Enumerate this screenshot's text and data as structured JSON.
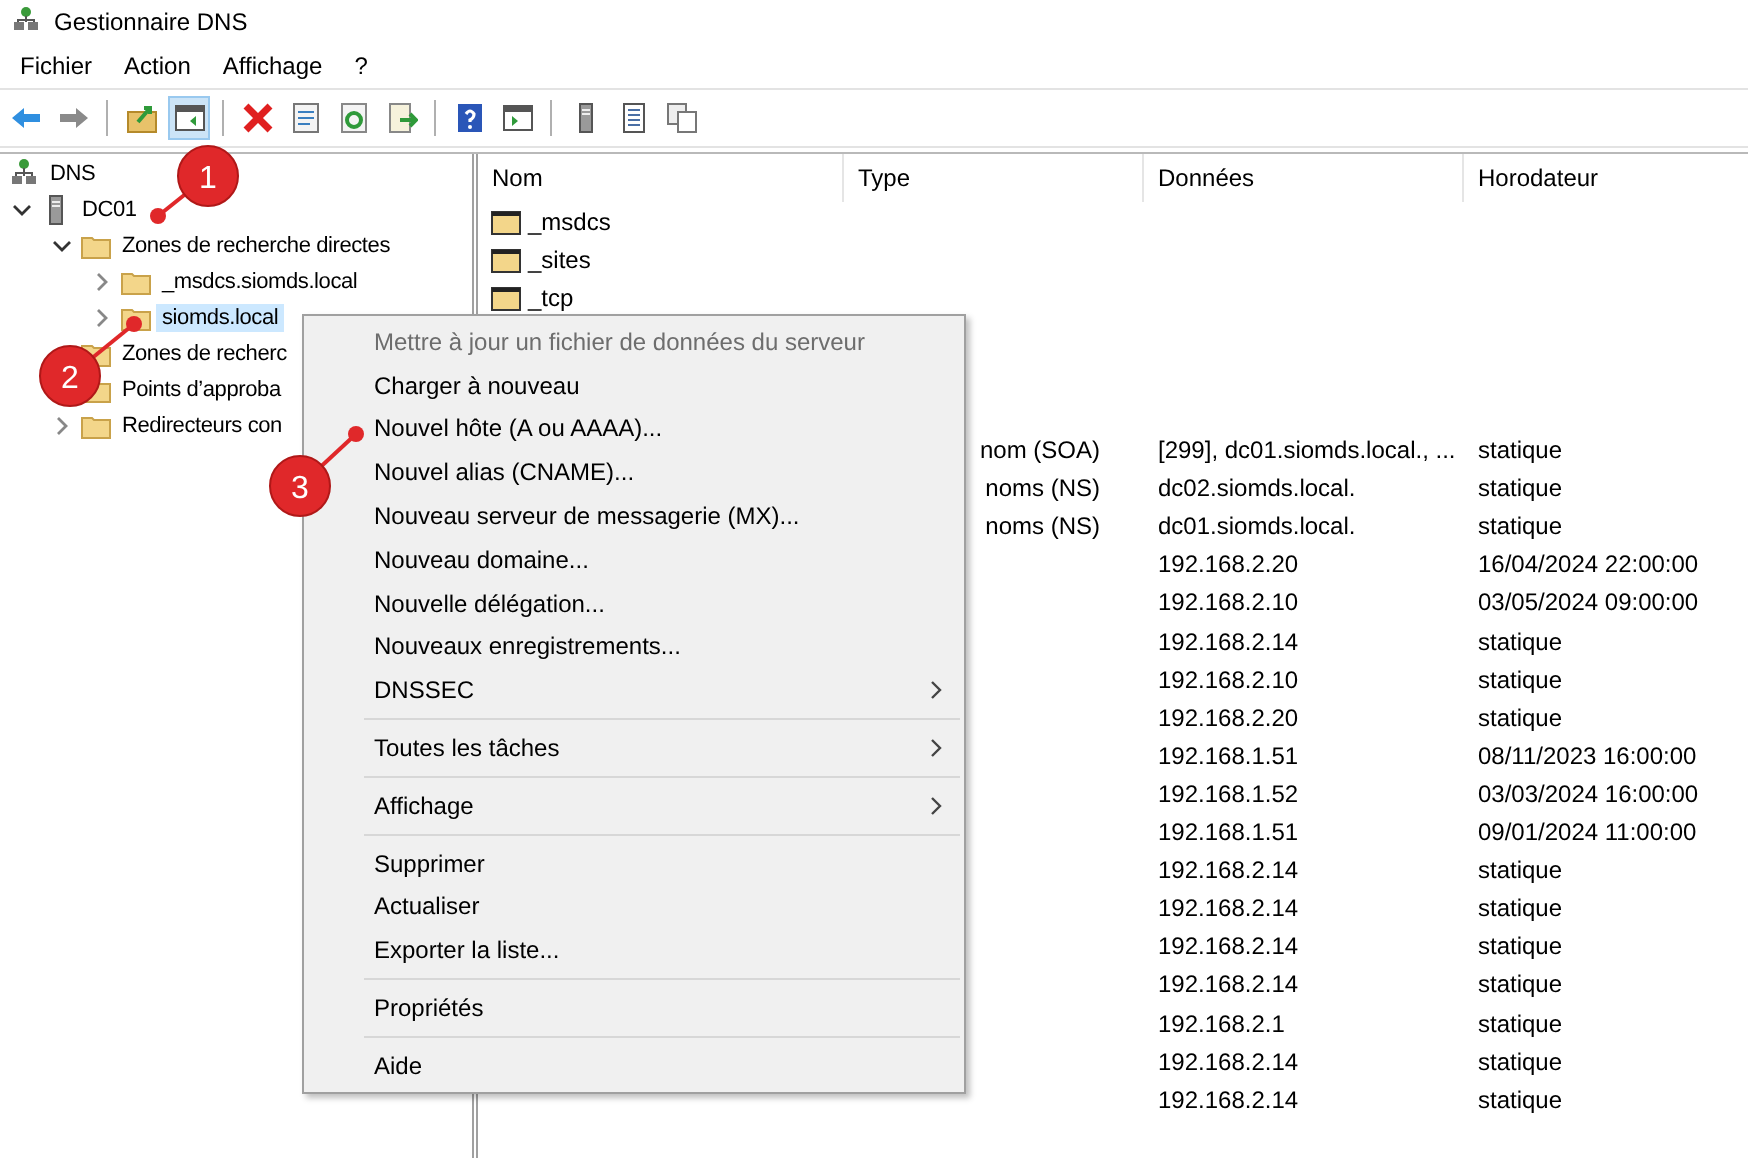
{
  "window": {
    "title": "Gestionnaire DNS"
  },
  "menu_bar": [
    "Fichier",
    "Action",
    "Affichage",
    "?"
  ],
  "toolbar": [
    [
      {
        "pressed": false
      },
      {
        "pressed": false
      }
    ],
    [
      {
        "pressed": false
      },
      {
        "pressed": true
      }
    ],
    [
      {
        "pressed": false
      },
      {
        "pressed": false
      },
      {
        "pressed": false
      },
      {
        "pressed": false
      }
    ],
    [
      {
        "pressed": false
      },
      {
        "pressed": false
      }
    ],
    [
      {
        "pressed": false
      },
      {
        "pressed": false
      },
      {
        "pressed": false
      }
    ]
  ],
  "tree": {
    "label": "DNS",
    "selected": false,
    "children": [
      {
        "label": "DC01",
        "selected": false,
        "expanded": true,
        "children": [
          {
            "label": "Zones de recherche directes",
            "selected": false,
            "expanded": true,
            "children": [
              {
                "label": "_msdcs.siomds.local",
                "selected": false,
                "expanded": false
              },
              {
                "label": "siomds.local",
                "selected": true,
                "expanded": false
              }
            ]
          },
          {
            "label": "Zones de recherc",
            "selected": false
          },
          {
            "label": "Points d’approba",
            "selected": false
          },
          {
            "label": "Redirecteurs con",
            "selected": false,
            "expanded": false
          }
        ]
      }
    ]
  },
  "table": {
    "columns": [
      "Nom",
      "Type",
      "Données",
      "Horodateur"
    ],
    "rows": [
      {
        "name": "_msdcs"
      },
      {
        "name": "_sites"
      },
      {
        "name": "_tcp"
      },
      {},
      {},
      {},
      {
        "type": "nom (SOA)",
        "data": "[299], dc01.siomds.local., ...",
        "timestamp": "statique"
      },
      {
        "type": "noms (NS)",
        "data": "dc02.siomds.local.",
        "timestamp": "statique"
      },
      {
        "type": "noms (NS)",
        "data": "dc01.siomds.local.",
        "timestamp": "statique"
      },
      {
        "data": "192.168.2.20",
        "timestamp": "16/04/2024 22:00:00"
      },
      {
        "data": "192.168.2.10",
        "timestamp": "03/05/2024 09:00:00"
      },
      {
        "data": "192.168.2.14",
        "timestamp": "statique"
      },
      {
        "data": "192.168.2.10",
        "timestamp": "statique"
      },
      {
        "data": "192.168.2.20",
        "timestamp": "statique"
      },
      {
        "data": "192.168.1.51",
        "timestamp": "08/11/2023 16:00:00"
      },
      {
        "data": "192.168.1.52",
        "timestamp": "03/03/2024 16:00:00"
      },
      {
        "data": "192.168.1.51",
        "timestamp": "09/01/2024 11:00:00"
      },
      {
        "data": "192.168.2.14",
        "timestamp": "statique"
      },
      {
        "data": "192.168.2.14",
        "timestamp": "statique"
      },
      {
        "data": "192.168.2.14",
        "timestamp": "statique"
      },
      {
        "data": "192.168.2.14",
        "timestamp": "statique"
      },
      {
        "data": "192.168.2.1",
        "timestamp": "statique"
      },
      {
        "data": "192.168.2.14",
        "timestamp": "statique"
      },
      {
        "data": "192.168.2.14",
        "timestamp": "statique"
      }
    ]
  },
  "context_menu": {
    "groups": [
      [
        {
          "label": "Mettre à jour un fichier de données du serveur",
          "disabled": true,
          "submenu": false
        },
        {
          "label": "Charger à nouveau",
          "disabled": false,
          "submenu": false
        },
        {
          "label": "Nouvel hôte (A ou AAAA)...",
          "disabled": false,
          "submenu": false
        },
        {
          "label": "Nouvel alias (CNAME)...",
          "disabled": false,
          "submenu": false
        },
        {
          "label": "Nouveau serveur de messagerie (MX)...",
          "disabled": false,
          "submenu": false
        },
        {
          "label": "Nouveau domaine...",
          "disabled": false,
          "submenu": false
        },
        {
          "label": "Nouvelle délégation...",
          "disabled": false,
          "submenu": false
        },
        {
          "label": "Nouveaux enregistrements...",
          "disabled": false,
          "submenu": false
        },
        {
          "label": "DNSSEC",
          "disabled": false,
          "submenu": true
        }
      ],
      [
        {
          "label": "Toutes les tâches",
          "disabled": false,
          "submenu": true
        }
      ],
      [
        {
          "label": "Affichage",
          "disabled": false,
          "submenu": true
        }
      ],
      [
        {
          "label": "Supprimer",
          "disabled": false,
          "submenu": false
        },
        {
          "label": "Actualiser",
          "disabled": false,
          "submenu": false
        },
        {
          "label": "Exporter la liste...",
          "disabled": false,
          "submenu": false
        }
      ],
      [
        {
          "label": "Propriétés",
          "disabled": false,
          "submenu": false
        }
      ],
      [
        {
          "label": "Aide",
          "disabled": false,
          "submenu": false
        }
      ]
    ]
  },
  "annotations": [
    {
      "label": "1"
    },
    {
      "label": "2"
    },
    {
      "label": "3"
    }
  ]
}
